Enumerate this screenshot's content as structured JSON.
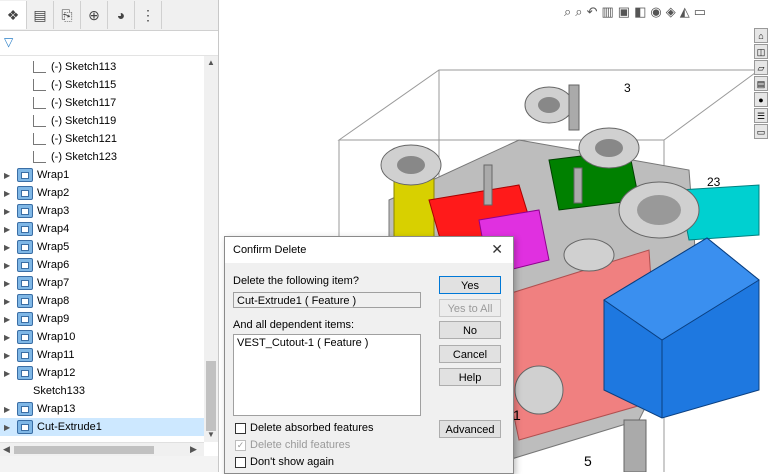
{
  "feature_manager": {
    "tabs": [
      {
        "name": "feature-tree-tab",
        "icon": "❖"
      },
      {
        "name": "property-manager-tab",
        "icon": "▤"
      },
      {
        "name": "configuration-manager-tab",
        "icon": "⎘"
      },
      {
        "name": "dimxpert-tab",
        "icon": "⊕"
      },
      {
        "name": "display-manager-tab",
        "icon": "◕"
      },
      {
        "name": "more-tabs",
        "icon": "⋮"
      }
    ],
    "filter_icon": "filter-icon",
    "tree_items": [
      {
        "label": "(-) Sketch113",
        "type": "sketch"
      },
      {
        "label": "(-) Sketch115",
        "type": "sketch"
      },
      {
        "label": "(-) Sketch117",
        "type": "sketch"
      },
      {
        "label": "(-) Sketch119",
        "type": "sketch"
      },
      {
        "label": "(-) Sketch121",
        "type": "sketch"
      },
      {
        "label": "(-) Sketch123",
        "type": "sketch"
      },
      {
        "label": "Wrap1",
        "type": "feature"
      },
      {
        "label": "Wrap2",
        "type": "feature"
      },
      {
        "label": "Wrap3",
        "type": "feature"
      },
      {
        "label": "Wrap4",
        "type": "feature"
      },
      {
        "label": "Wrap5",
        "type": "feature"
      },
      {
        "label": "Wrap6",
        "type": "feature"
      },
      {
        "label": "Wrap7",
        "type": "feature"
      },
      {
        "label": "Wrap8",
        "type": "feature"
      },
      {
        "label": "Wrap9",
        "type": "feature"
      },
      {
        "label": "Wrap10",
        "type": "feature"
      },
      {
        "label": "Wrap11",
        "type": "feature"
      },
      {
        "label": "Wrap12",
        "type": "feature"
      },
      {
        "label": "Sketch133",
        "type": "sketch-plain"
      },
      {
        "label": "Wrap13",
        "type": "feature"
      },
      {
        "label": "Cut-Extrude1",
        "type": "feature-selected"
      }
    ]
  },
  "dialog": {
    "title": "Confirm Delete",
    "close": "✕",
    "delete_label": "Delete the following item?",
    "item": "Cut-Extrude1 ( Feature )",
    "dependents_label": "And all dependent items:",
    "dependents": [
      "VEST_Cutout-1 ( Feature )"
    ],
    "buttons": {
      "yes": "Yes",
      "yes_to_all": "Yes to All",
      "no": "No",
      "cancel": "Cancel",
      "help": "Help",
      "advanced": "Advanced"
    },
    "checkboxes": {
      "absorbed": "Delete absorbed features",
      "child": "Delete child features",
      "dont_show": "Don't show again"
    }
  },
  "model_labels": [
    "3",
    "23",
    "1",
    "5"
  ],
  "colors": {
    "selection": "#cde8ff",
    "yellow_part": "#d8d000",
    "red_part": "#ff1a1a",
    "magenta_part": "#e030e0",
    "green_part": "#008000",
    "cyan_part": "#00d0d0",
    "pink_part": "#f08080",
    "blue_selected_body": "#1e78e0"
  }
}
